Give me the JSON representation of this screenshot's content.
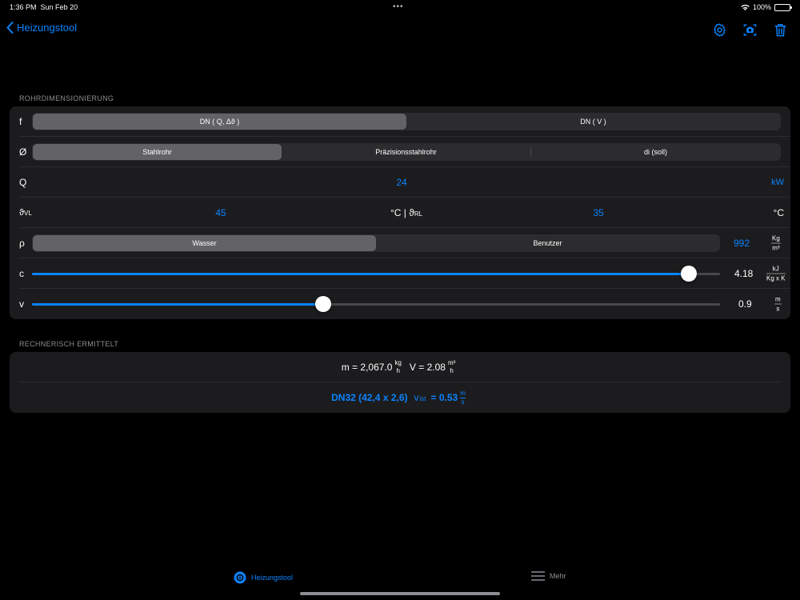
{
  "status": {
    "time": "1:36 PM",
    "date": "Sun Feb 20",
    "battery": "100%",
    "battery_level": 1.0
  },
  "nav": {
    "back_label": "Heizungstool",
    "icons": [
      "gear-icon",
      "camera-icon",
      "trash-icon"
    ]
  },
  "section1": {
    "header": "ROHRDIMENSIONIERUNG",
    "f": {
      "label": "f",
      "options": [
        "DN ( Q, Δϑ )",
        "DN ( V )"
      ],
      "selected": 0
    },
    "o": {
      "label": "Ø",
      "options": [
        "Stahlrohr",
        "Präzisionsstahlrohr",
        "di (soll)"
      ],
      "selected": 0
    },
    "q": {
      "label": "Q",
      "value": "24",
      "unit": "kW"
    },
    "temp": {
      "label_vl": "ϑ",
      "sub_vl": "VL",
      "value_vl": "45",
      "separator": "°C | ϑ",
      "sub_rl": "RL",
      "value_rl": "35",
      "unit": "°C"
    },
    "rho": {
      "label": "ρ",
      "options": [
        "Wasser",
        "Benutzer"
      ],
      "selected": 0,
      "value": "992",
      "unit_num": "Kg",
      "unit_den": "m³"
    },
    "c": {
      "label": "c",
      "value": "4.18",
      "fraction": 0.955,
      "unit_num": "kJ",
      "unit_den": "Kg x K"
    },
    "v": {
      "label": "v",
      "value": "0.9",
      "fraction": 0.423,
      "unit_num": "m",
      "unit_den": "s"
    }
  },
  "section2": {
    "header": "RECHNERISCH ERMITTELT",
    "m_text": "m = 2,067.0",
    "m_unit_num": "kg",
    "m_unit_den": "h",
    "V_text": "V = 2.08",
    "V_unit_num": "m³",
    "V_unit_den": "h",
    "dn_text": "DN32 (42,4 x 2,6)",
    "vist_label": "v",
    "vist_sub": "ist",
    "vist_text": "= 0.53",
    "vist_unit_num": "m",
    "vist_unit_den": "s"
  },
  "tabbar": {
    "tab1": "Heizungstool",
    "tab2": "Mehr",
    "active": 0
  },
  "colors": {
    "accent": "#0a84ff",
    "card": "#1c1c1e",
    "background": "#000000"
  }
}
